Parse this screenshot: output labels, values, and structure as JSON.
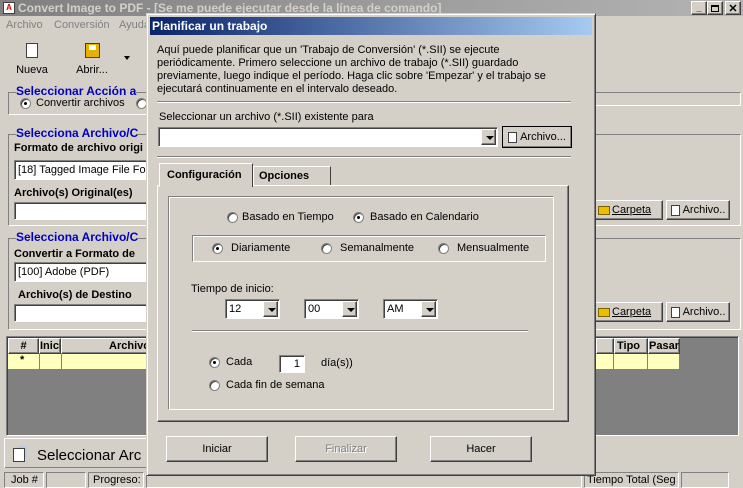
{
  "main_window": {
    "title": "Convert Image to PDF - [Se me puede ejecutar desde la línea de comando]",
    "menu": [
      "Archivo",
      "Conversión",
      "Ayuda"
    ],
    "toolbar": {
      "new_label": "Nueva",
      "open_label": "Abrir..."
    },
    "section_action": "Seleccionar Acción a",
    "radio_convert": "Convertir archivos",
    "section_source": "Selecciona Archivo/C",
    "source_format_label": "Formato de archivo origi",
    "source_format_value": "[18] Tagged Image File For",
    "original_files_label": "Archivo(s) Original(es)",
    "section_dest": "Selecciona Archivo/C",
    "dest_format_label": "Convertir a Formato de",
    "dest_format_value": "[100] Adobe (PDF)",
    "dest_files_label": "Archivo(s) de Destino",
    "folder_button": "Carpeta",
    "file_button": "Archivo..",
    "table_headers": {
      "num": "#",
      "ini": "Inici",
      "arch": "Archivo",
      "tipo": "Tipo",
      "pasar": "Pasar"
    },
    "table_row_marker": "*",
    "bottom_tab": "Seleccionar Arc",
    "status": {
      "job": "Job #",
      "progress": "Progreso:",
      "total_time": "Tiempo Total (Seg"
    }
  },
  "dialog": {
    "title": "Planificar un trabajo",
    "description": "Aquí puede planificar que un 'Trabajo de Conversión' (*.SII) se ejecute periódicamente. Primero seleccione un archivo de trabajo (*.SII) guardado previamente, luego indique el período. Haga clic sobre 'Empezar' y el trabajo se ejecutará continuamente en el intervalo deseado.",
    "select_file_label": "Seleccionar un archivo (*.SII) existente para",
    "select_file_value": "",
    "file_button": "Archivo...",
    "tabs": [
      "Configuración",
      "Opciones"
    ],
    "radio_time_based": "Basado en Tiempo",
    "radio_calendar_based": "Basado en Calendario",
    "radio_daily": "Diariamente",
    "radio_weekly": "Semanalmente",
    "radio_monthly": "Mensualmente",
    "start_time_label": "Tiempo de inicio:",
    "hour_value": "12",
    "minute_value": "00",
    "ampm_value": "AM",
    "every_label": "Cada",
    "every_value": "1",
    "days_label": "día(s))",
    "weekend_label": "Cada fin de semana",
    "start_button": "Iniciar",
    "finish_button": "Finalizar",
    "do_button": "Hacer"
  },
  "colors": {
    "title_active": "#0a246a",
    "title_inactive": "#808080",
    "accent_text": "#0000c0",
    "highlight_row": "#ffffc0"
  }
}
